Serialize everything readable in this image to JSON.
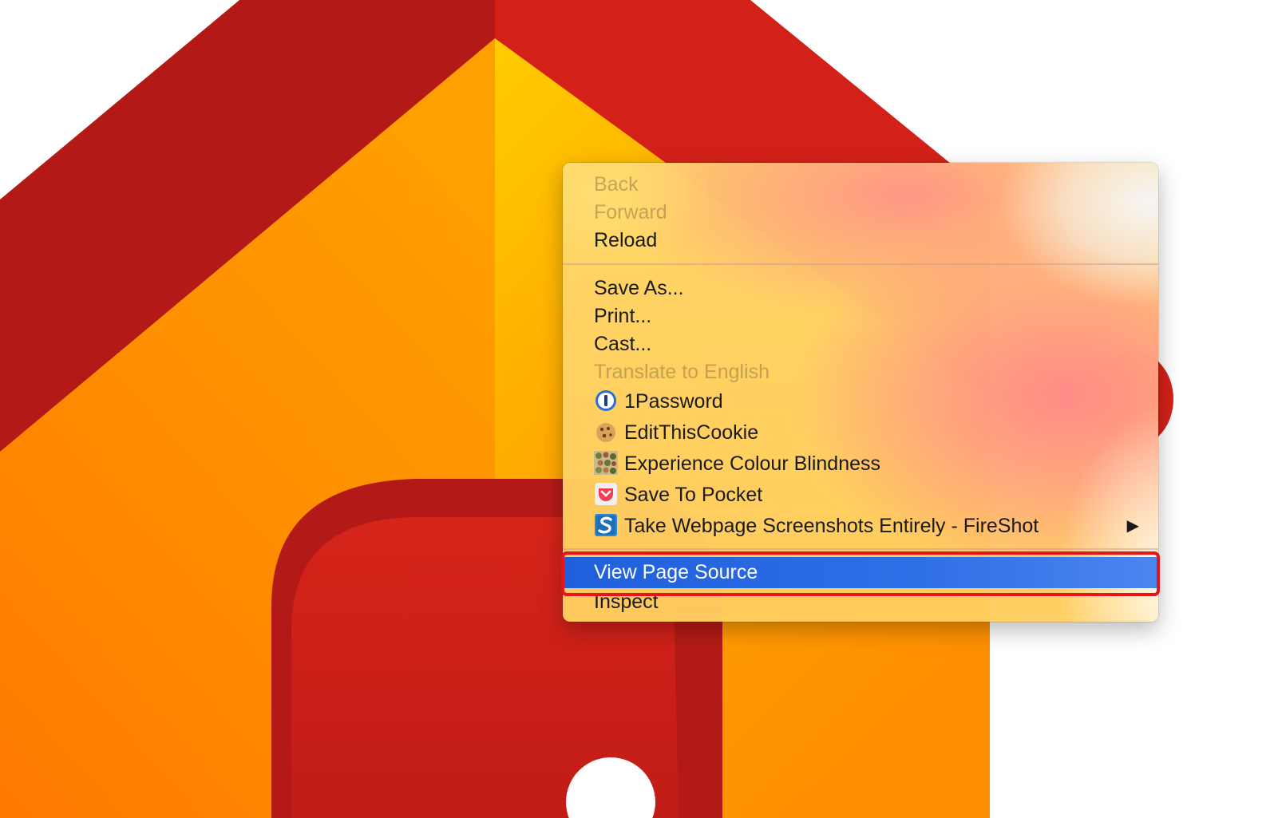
{
  "background": {
    "description_colors": {
      "dark_red": "#b31a17",
      "red": "#d32119",
      "orange": "#ff8f00",
      "yellow": "#ffc107",
      "white": "#ffffff"
    }
  },
  "context_menu": {
    "group1": [
      {
        "label": "Back",
        "enabled": false
      },
      {
        "label": "Forward",
        "enabled": false
      },
      {
        "label": "Reload",
        "enabled": true
      }
    ],
    "group2": [
      {
        "label": "Save As...",
        "enabled": true
      },
      {
        "label": "Print...",
        "enabled": true
      },
      {
        "label": "Cast...",
        "enabled": true
      },
      {
        "label": "Translate to English",
        "enabled": false
      }
    ],
    "extensions": [
      {
        "label": "1Password",
        "icon": "1password-icon"
      },
      {
        "label": "EditThisCookie",
        "icon": "cookie-icon"
      },
      {
        "label": "Experience Colour Blindness",
        "icon": "colour-blindness-icon"
      },
      {
        "label": "Save To Pocket",
        "icon": "pocket-icon"
      },
      {
        "label": "Take Webpage Screenshots Entirely - FireShot",
        "icon": "fireshot-icon",
        "submenu_arrow": "▶"
      }
    ],
    "group3": [
      {
        "label": "View Page Source",
        "highlighted": true
      },
      {
        "label": "Inspect"
      }
    ],
    "highlight_color": "#2b6be4",
    "annotation_color": "#e8141c"
  }
}
